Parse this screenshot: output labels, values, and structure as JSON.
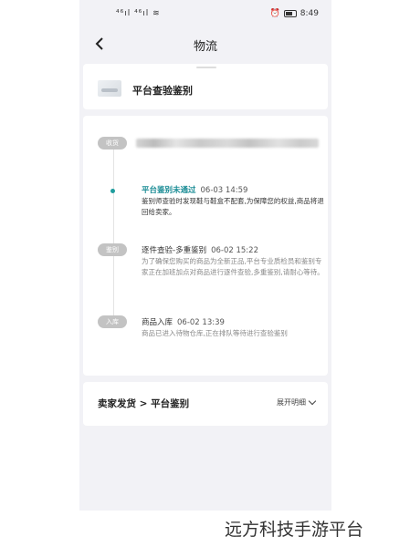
{
  "status_bar": {
    "signal": "⁴⁶ıl ⁴⁶ıl ≋",
    "time": "8:49"
  },
  "nav": {
    "title": "物流"
  },
  "product": {
    "name": "平台查验鉴别"
  },
  "timeline": {
    "receiver_tag": "收货",
    "events": [
      {
        "tag": "",
        "status": "平台鉴别未通过",
        "time": "06-03 14:59",
        "description": "鉴别师查验时发现鞋与鞋盒不配套,为保障您的权益,商品将退回给卖家。"
      },
      {
        "tag": "鉴别",
        "status": "逐件查验-多重鉴别",
        "time": "06-02 15:22",
        "description": "为了确保您购买的商品为全新正品,平台专业质检员和鉴别专家正在加班加点对商品进行逐件查验,多重鉴别,请耐心等待。"
      },
      {
        "tag": "入库",
        "status": "商品入库",
        "time": "06-02 13:39",
        "description": "商品已进入待物仓库,正在排队等待进行查验鉴别"
      }
    ]
  },
  "shipping": {
    "title": "卖家发货 > 平台鉴别",
    "expand_label": "展开明细"
  },
  "watermark": "远方科技手游平台",
  "colors": {
    "accent": "#1a8c95",
    "background": "#f2f2f6"
  }
}
